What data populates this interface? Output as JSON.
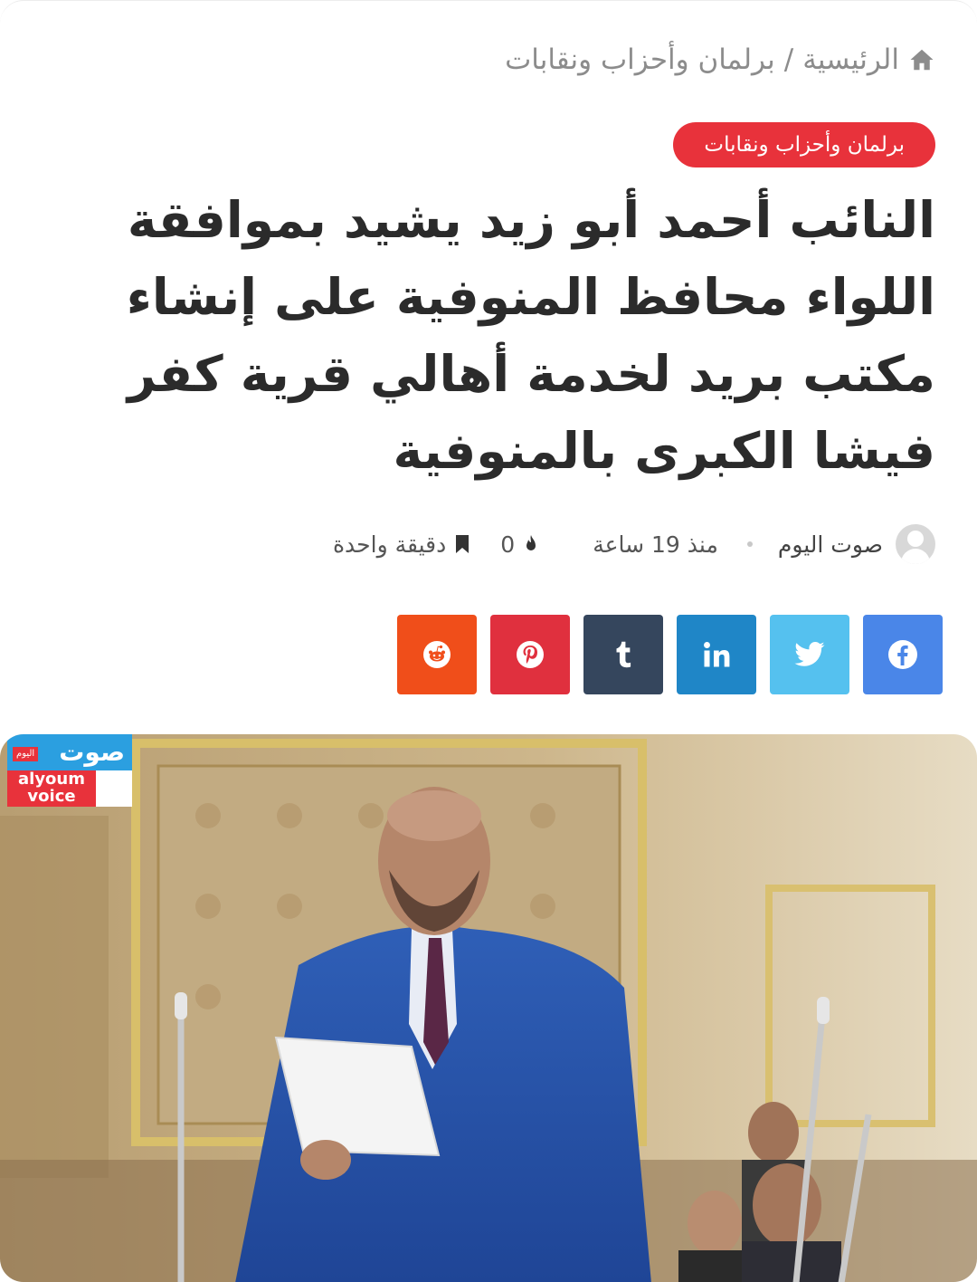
{
  "breadcrumb": {
    "home": "الرئيسية",
    "separator": "/",
    "section": "برلمان وأحزاب ونقابات"
  },
  "category": "برلمان وأحزاب ونقابات",
  "title": "النائب أحمد أبو زيد يشيد بموافقة اللواء محافظ المنوفية على إنشاء مكتب بريد لخدمة أهالي قرية كفر فيشا الكبرى بالمنوفية",
  "meta": {
    "author": "صوت اليوم",
    "time": "منذ 19 ساعة",
    "views": "0",
    "read_time": "دقيقة واحدة"
  },
  "share": [
    {
      "network": "facebook",
      "icon": "facebook-icon",
      "color": "#4a86e8"
    },
    {
      "network": "twitter",
      "icon": "twitter-icon",
      "color": "#55c1ef"
    },
    {
      "network": "linkedin",
      "icon": "linkedin-icon",
      "color": "#1f86c7"
    },
    {
      "network": "tumblr",
      "icon": "tumblr-icon",
      "color": "#35465d"
    },
    {
      "network": "pinterest",
      "icon": "pinterest-icon",
      "color": "#e0303e"
    },
    {
      "network": "reddit",
      "icon": "reddit-icon",
      "color": "#f04e1a"
    }
  ],
  "photo": {
    "logo_line1": "صوت",
    "logo_tag": "اليوم",
    "logo_line2": "alyoum",
    "logo_line3": "voice"
  },
  "colors": {
    "accent": "#e8323b",
    "text": "#2b2b2b",
    "muted": "#8c8c8c"
  }
}
